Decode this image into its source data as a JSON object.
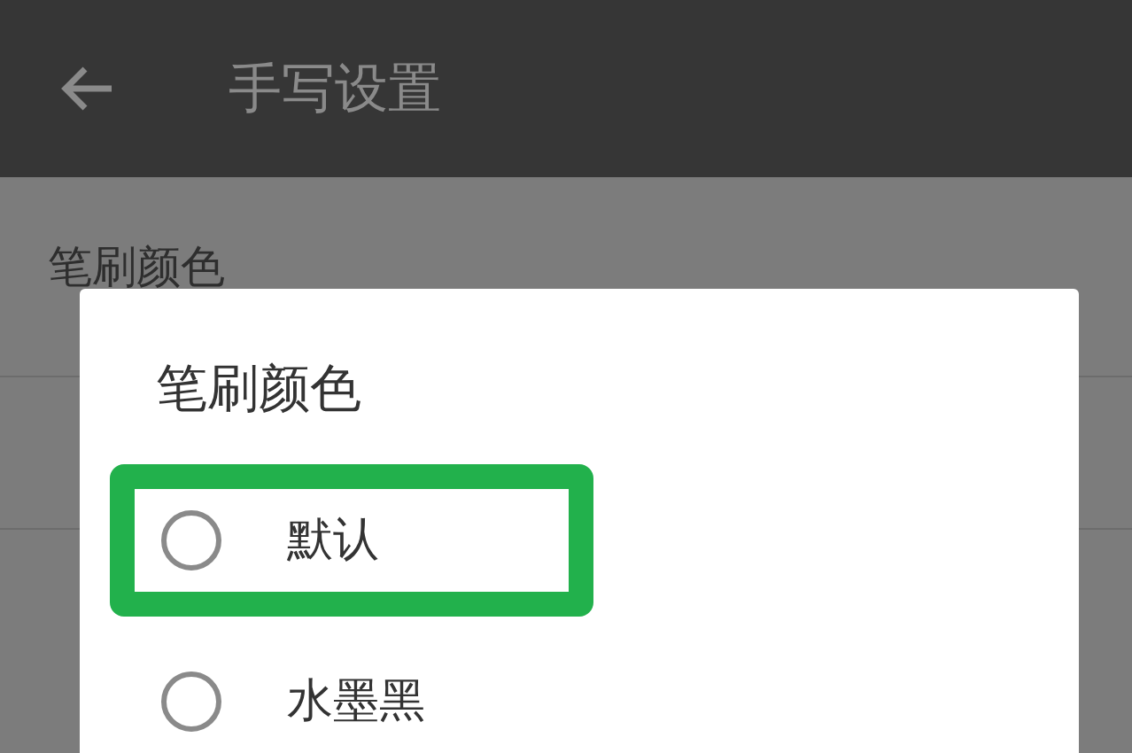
{
  "app_bar": {
    "title": "手写设置"
  },
  "settings": [
    {
      "title": "笔刷颜色"
    }
  ],
  "dialog": {
    "title": "笔刷颜色",
    "options": [
      {
        "label": "默认",
        "selected": false,
        "highlighted": true
      },
      {
        "label": "水墨黑",
        "selected": false,
        "highlighted": false
      }
    ]
  }
}
